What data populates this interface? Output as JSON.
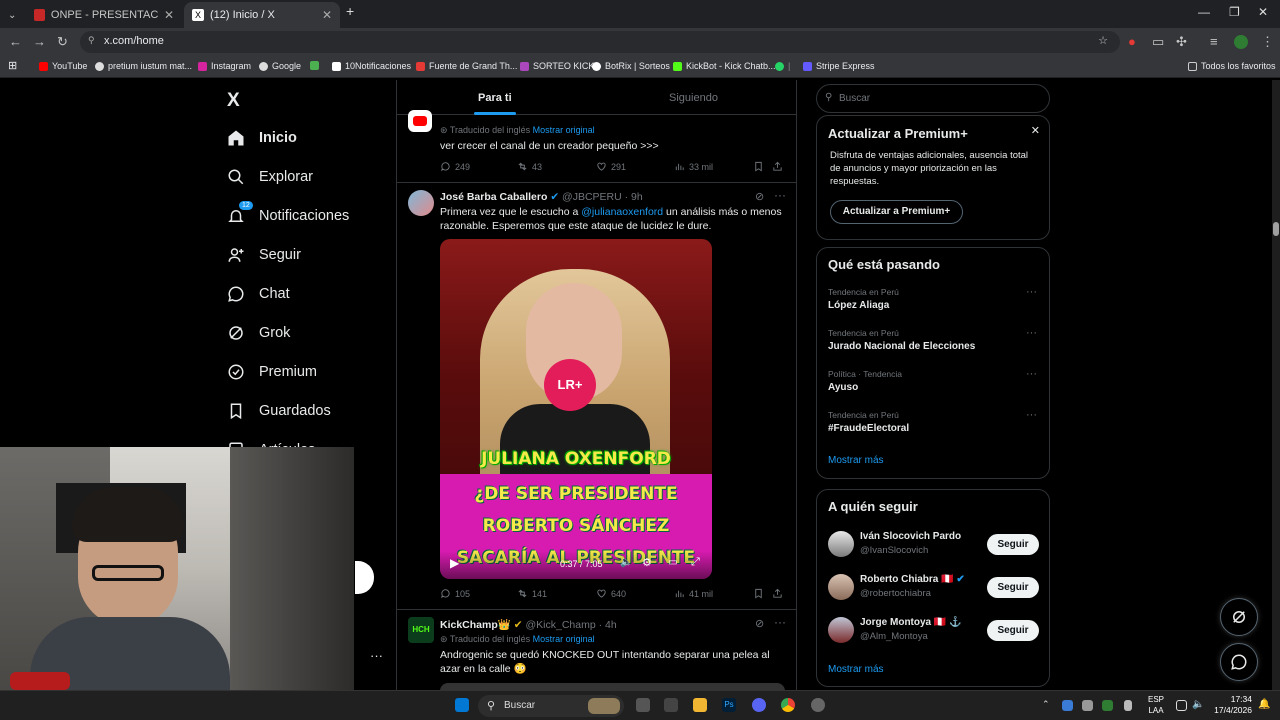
{
  "browser": {
    "tabs": [
      {
        "title": "ONPE - PRESENTACIÓN DE RES",
        "active": false
      },
      {
        "title": "(12) Inicio / X",
        "active": true
      }
    ],
    "url": "x.com/home",
    "bookmarks": [
      "YouTube",
      "pretium iustum mat...",
      "Instagram",
      "Google",
      "10Notificaciones",
      "Fuente de Grand Th...",
      "SORTEO KICK",
      "BotRix | Sorteos",
      "KickBot - Kick Chatb...",
      "Stripe Express",
      "Todos los favoritos"
    ]
  },
  "sidebar": {
    "logo": "X",
    "items": [
      {
        "label": "Inicio",
        "icon": "home-icon"
      },
      {
        "label": "Explorar",
        "icon": "search-icon"
      },
      {
        "label": "Notificaciones",
        "icon": "bell-icon",
        "badge": "12"
      },
      {
        "label": "Seguir",
        "icon": "person-add-icon"
      },
      {
        "label": "Chat",
        "icon": "chat-icon"
      },
      {
        "label": "Grok",
        "icon": "grok-icon"
      },
      {
        "label": "Premium",
        "icon": "premium-icon"
      },
      {
        "label": "Guardados",
        "icon": "bookmark-icon"
      },
      {
        "label": "Artículos",
        "icon": "article-icon"
      }
    ],
    "more": "···"
  },
  "feed": {
    "tabs": [
      "Para ti",
      "Siguiendo"
    ],
    "tweets": [
      {
        "translated": "Traducido del inglés",
        "show_original": "Mostrar original",
        "text": "ver crecer el canal de un creador pequeño >>>",
        "replies": "249",
        "reposts": "43",
        "likes": "291",
        "views": "33 mil"
      },
      {
        "name": "José Barba Caballero",
        "handle": "@JBCPERU · 9h",
        "text_pre": "Primera vez que le escucho a ",
        "mention": "@julianaoxenford",
        "text_post": " un análisis más o menos razonable. Esperemos que este ataque de lucidez le dure.",
        "video": {
          "name_banner": "JULIANA OXENFORD",
          "headline": "¿DE SER PRESIDENTE ROBERTO SÁNCHEZ SACARÍA AL PRESIDENTE DEL BCR JULIO VELARDE?",
          "time": "0:37 / 7:05",
          "mic_logo": "LR+"
        },
        "replies": "105",
        "reposts": "141",
        "likes": "640",
        "views": "41 mil"
      },
      {
        "name": "KickChamp👑",
        "handle": "@Kick_Champ · 4h",
        "translated": "Traducido del inglés",
        "show_original": "Mostrar original",
        "text": "Androgenic se quedó KNOCKED OUT intentando separar una pelea al azar en la calle 😳"
      }
    ]
  },
  "right": {
    "search_placeholder": "Buscar",
    "premium": {
      "title": "Actualizar a Premium+",
      "body": "Disfruta de ventajas adicionales, ausencia total de anuncios y mayor priorización en las respuestas.",
      "button": "Actualizar a Premium+"
    },
    "trends": {
      "title": "Qué está pasando",
      "items": [
        {
          "category": "Tendencia en Perú",
          "name": "López Aliaga"
        },
        {
          "category": "Tendencia en Perú",
          "name": "Jurado Nacional de Elecciones"
        },
        {
          "category": "Política · Tendencia",
          "name": "Ayuso"
        },
        {
          "category": "Tendencia en Perú",
          "name": "#FraudeElectoral"
        }
      ],
      "more": "Mostrar más"
    },
    "who_to_follow": {
      "title": "A quién seguir",
      "users": [
        {
          "name": "Iván Slocovich Pardo",
          "handle": "@IvanSlocovich"
        },
        {
          "name": "Roberto Chiabra 🇵🇪",
          "handle": "@robertochiabra"
        },
        {
          "name": "Jorge Montoya 🇵🇪 ⚓",
          "handle": "@Alm_Montoya"
        }
      ],
      "follow_label": "Seguir",
      "more": "Mostrar más"
    }
  },
  "taskbar": {
    "search": "Buscar",
    "lang": [
      "ESP",
      "LAA"
    ],
    "time": "17:34",
    "date": "17/4/2026"
  }
}
